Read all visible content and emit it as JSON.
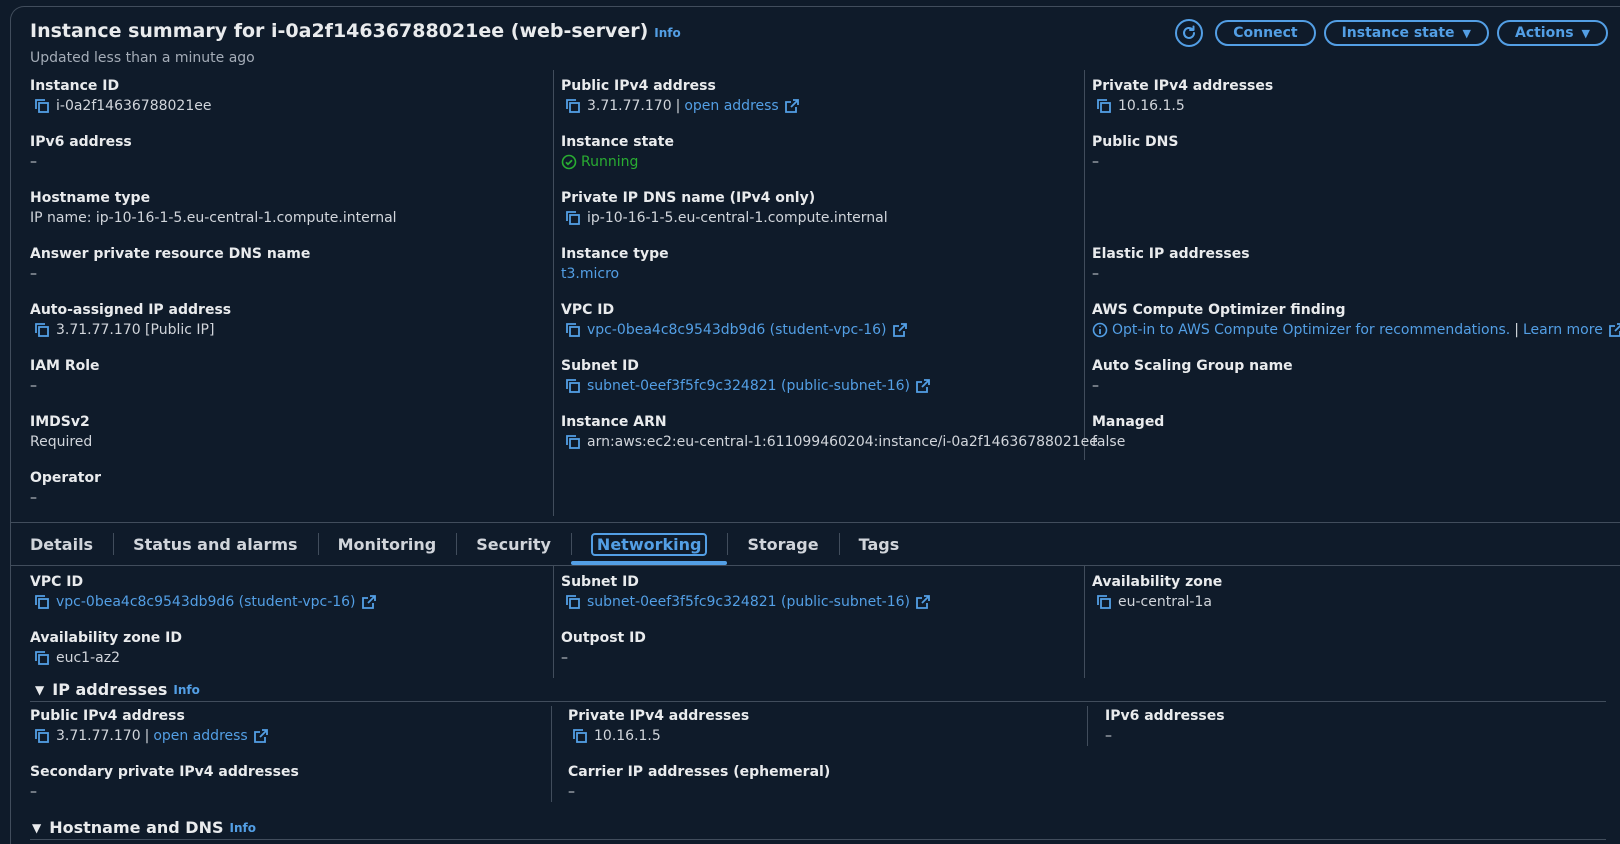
{
  "header": {
    "title": "Instance summary for i-0a2f14636788021ee (web-server)",
    "info": "Info",
    "subtitle": "Updated less than a minute ago",
    "buttons": {
      "connect": "Connect",
      "instance_state": "Instance state",
      "actions": "Actions"
    }
  },
  "summary": {
    "col1": [
      {
        "label": "Instance ID",
        "value": "i-0a2f14636788021ee"
      },
      {
        "label": "IPv6 address",
        "value": "–"
      },
      {
        "label": "Hostname type",
        "value": "IP name: ip-10-16-1-5.eu-central-1.compute.internal"
      },
      {
        "label": "Answer private resource DNS name",
        "value": "–"
      },
      {
        "label": "Auto-assigned IP address",
        "value": "3.71.77.170 [Public IP]"
      },
      {
        "label": "IAM Role",
        "value": "–"
      },
      {
        "label": "IMDSv2",
        "value": "Required"
      },
      {
        "label": "Operator",
        "value": "–"
      }
    ],
    "col2": [
      {
        "label": "Public IPv4 address",
        "value": "3.71.77.170",
        "link": "open address"
      },
      {
        "label": "Instance state",
        "value": "Running"
      },
      {
        "label": "Private IP DNS name (IPv4 only)",
        "value": "ip-10-16-1-5.eu-central-1.compute.internal"
      },
      {
        "label": "Instance type",
        "value": "t3.micro"
      },
      {
        "label": "VPC ID",
        "value": "vpc-0bea4c8c9543db9d6 (student-vpc-16)"
      },
      {
        "label": "Subnet ID",
        "value": "subnet-0eef3f5fc9c324821 (public-subnet-16)"
      },
      {
        "label": "Instance ARN",
        "value": "arn:aws:ec2:eu-central-1:611099460204:instance/i-0a2f14636788021ee"
      }
    ],
    "col3": [
      {
        "label": "Private IPv4 addresses",
        "value": "10.16.1.5"
      },
      {
        "label": "Public DNS",
        "value": "–"
      },
      {
        "label": "Elastic IP addresses",
        "value": "–"
      },
      {
        "label": "AWS Compute Optimizer finding",
        "value": "Opt-in to AWS Compute Optimizer for recommendations.",
        "link": "Learn more"
      },
      {
        "label": "Auto Scaling Group name",
        "value": "–"
      },
      {
        "label": "Managed",
        "value": "false"
      }
    ]
  },
  "tabs": [
    "Details",
    "Status and alarms",
    "Monitoring",
    "Security",
    "Networking",
    "Storage",
    "Tags"
  ],
  "networking": {
    "vpc": {
      "label": "VPC ID",
      "value": "vpc-0bea4c8c9543db9d6 (student-vpc-16)"
    },
    "subnet": {
      "label": "Subnet ID",
      "value": "subnet-0eef3f5fc9c324821 (public-subnet-16)"
    },
    "az": {
      "label": "Availability zone",
      "value": "eu-central-1a"
    },
    "azid": {
      "label": "Availability zone ID",
      "value": "euc1-az2"
    },
    "outpost": {
      "label": "Outpost ID",
      "value": "–"
    },
    "ip_section": {
      "title": "IP addresses",
      "info": "Info"
    },
    "public_ipv4": {
      "label": "Public IPv4 address",
      "value": "3.71.77.170",
      "link": "open address"
    },
    "private_ipv4": {
      "label": "Private IPv4 addresses",
      "value": "10.16.1.5"
    },
    "ipv6": {
      "label": "IPv6 addresses",
      "value": "–"
    },
    "secondary": {
      "label": "Secondary private IPv4 addresses",
      "value": "–"
    },
    "carrier": {
      "label": "Carrier IP addresses (ephemeral)",
      "value": "–"
    },
    "dns_section": {
      "title": "Hostname and DNS",
      "info": "Info"
    }
  },
  "colors": {
    "background": "#0f1b2a",
    "accent": "#539fe5",
    "success": "#29ad32",
    "border": "#414d5c"
  },
  "icons": [
    "refresh-icon",
    "copy-icon",
    "external-link-icon",
    "check-circle-icon",
    "info-circle-icon",
    "caret-down-icon"
  ]
}
